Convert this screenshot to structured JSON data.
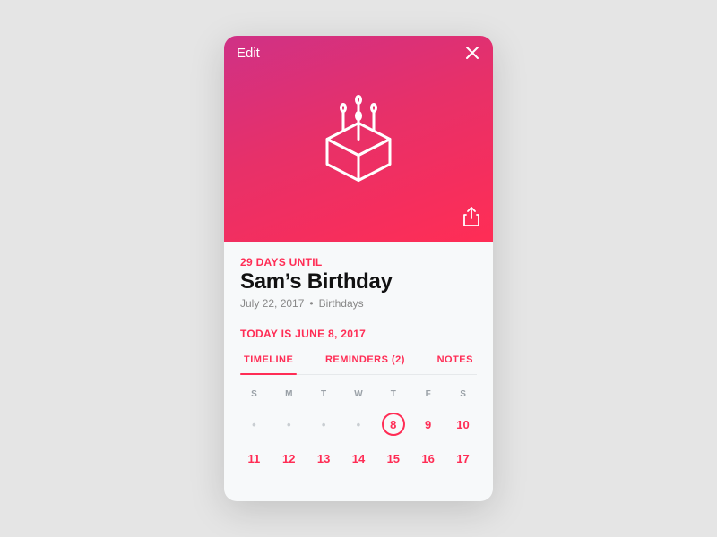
{
  "hero": {
    "edit_label": "Edit",
    "icon_name": "birthday-cake-icon"
  },
  "event": {
    "countdown": "29 DAYS UNTIL",
    "title": "Sam’s Birthday",
    "date": "July 22, 2017",
    "category": "Birthdays"
  },
  "today_line": "TODAY IS JUNE 8, 2017",
  "tabs": {
    "timeline": "TIMELINE",
    "reminders": "REMINDERS (2)",
    "notes": "NOTES",
    "active": "timeline"
  },
  "calendar": {
    "dow": [
      "S",
      "M",
      "T",
      "W",
      "T",
      "F",
      "S"
    ],
    "rows": [
      [
        {
          "v": "•",
          "dim": true
        },
        {
          "v": "•",
          "dim": true
        },
        {
          "v": "•",
          "dim": true
        },
        {
          "v": "•",
          "dim": true
        },
        {
          "v": "8",
          "today": true
        },
        {
          "v": "9"
        },
        {
          "v": "10"
        }
      ],
      [
        {
          "v": "11"
        },
        {
          "v": "12"
        },
        {
          "v": "13"
        },
        {
          "v": "14"
        },
        {
          "v": "15"
        },
        {
          "v": "16"
        },
        {
          "v": "17"
        }
      ]
    ]
  }
}
